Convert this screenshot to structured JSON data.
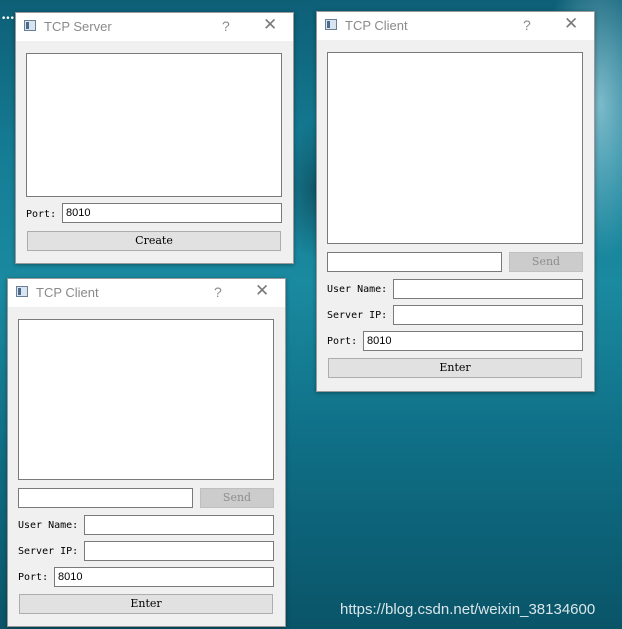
{
  "desktop": {
    "watermark": "https://blog.csdn.net/weixin_38134600",
    "corner_dots": "•••"
  },
  "server_window": {
    "title": "TCP Server",
    "help": "?",
    "close": "✕",
    "port_label": "Port:",
    "port_value": "8010",
    "create_label": "Create"
  },
  "client_window_right": {
    "title": "TCP Client",
    "help": "?",
    "close": "✕",
    "message_value": "",
    "send_label": "Send",
    "username_label": "User Name:",
    "username_value": "",
    "serverip_label": "Server IP:",
    "serverip_value": "",
    "port_label": "Port:",
    "port_value": "8010",
    "enter_label": "Enter"
  },
  "client_window_left": {
    "title": "TCP Client",
    "help": "?",
    "close": "✕",
    "message_value": "",
    "send_label": "Send",
    "username_label": "User Name:",
    "username_value": "",
    "serverip_label": "Server IP:",
    "serverip_value": "",
    "port_label": "Port:",
    "port_value": "8010",
    "enter_label": "Enter"
  }
}
